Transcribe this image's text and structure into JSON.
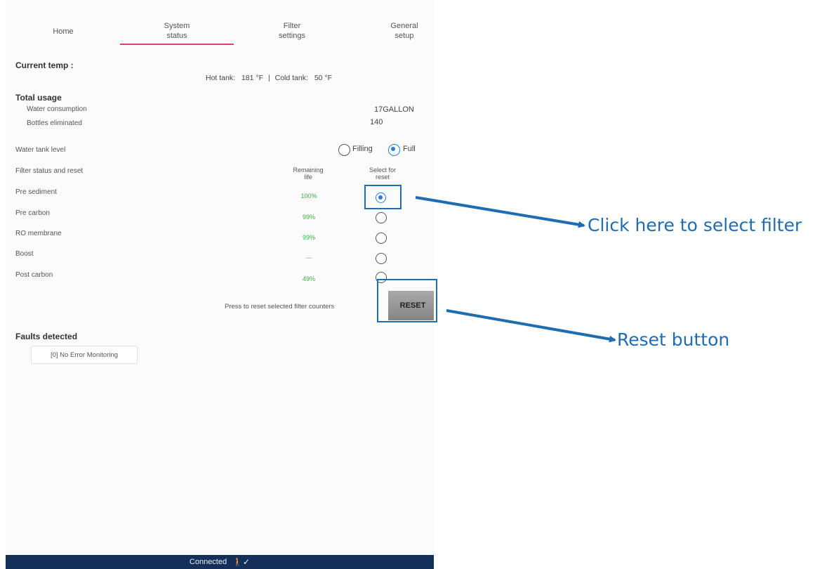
{
  "tabs": [
    {
      "label": "Home"
    },
    {
      "label": "System\nstatus"
    },
    {
      "label": "Filter\nsettings"
    },
    {
      "label": "General\nsetup"
    }
  ],
  "current_temp": {
    "heading": "Current temp :",
    "hot_label": "Hot tank:",
    "hot_value": "181",
    "unit": "°F",
    "separator": "|",
    "cold_label": "Cold tank:",
    "cold_value": "50"
  },
  "total_usage": {
    "heading": "Total usage",
    "rows": [
      {
        "label": "Water consumption",
        "value": "17GALLON"
      },
      {
        "label": "Bottles eliminated",
        "value": "140"
      }
    ]
  },
  "water_tank": {
    "label": "Water tank level",
    "options": [
      "Filling",
      "Full"
    ],
    "selected": "Full"
  },
  "filters": {
    "label": "Filter status and reset",
    "col_remaining": "Remaining\nlife",
    "col_select": "Select for\nreset",
    "rows": [
      {
        "name": "Pre sediment",
        "life": "100%",
        "selected": true
      },
      {
        "name": "Pre carbon",
        "life": "99%",
        "selected": false
      },
      {
        "name": "RO membrane",
        "life": "99%",
        "selected": false
      },
      {
        "name": "Boost",
        "life": "---",
        "selected": false
      },
      {
        "name": "Post carbon",
        "life": "49%",
        "selected": false
      }
    ],
    "reset_prompt": "Press to reset selected filter counters",
    "reset_label": "RESET"
  },
  "faults": {
    "heading": "Faults detected",
    "message": "[0] No Error Monitoring"
  },
  "status_bar": {
    "text": "Connected",
    "icon": "person-check-icon"
  },
  "annotations": {
    "select_filter": "Click here to select filter",
    "reset_button": "Reset button",
    "color": "#1f6cb1"
  }
}
